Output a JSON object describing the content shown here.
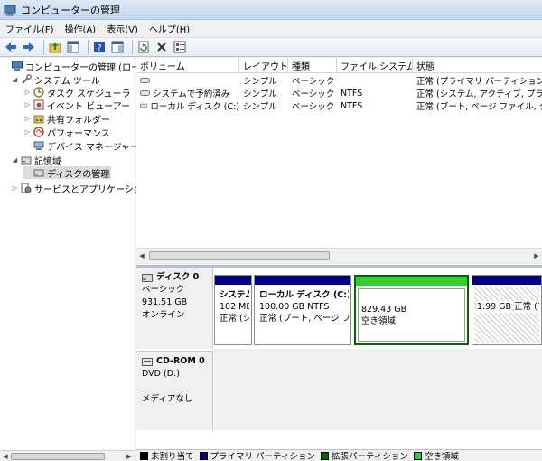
{
  "window": {
    "title": "コンピューターの管理"
  },
  "menu": [
    "ファイル(F)",
    "操作(A)",
    "表示(V)",
    "ヘルプ(H)"
  ],
  "tree": {
    "root": "コンピューターの管理 (ローカル)",
    "system_tools": "システム ツール",
    "task_scheduler": "タスク スケジューラ",
    "event_viewer": "イベント ビューアー",
    "shared_folders": "共有フォルダー",
    "performance": "パフォーマンス",
    "device_manager": "デバイス マネージャー",
    "storage": "記憶域",
    "disk_management": "ディスクの管理",
    "services_apps": "サービスとアプリケーション"
  },
  "volumes": {
    "columns": [
      "ボリューム",
      "レイアウト",
      "種類",
      "ファイル システム",
      "状態"
    ],
    "rows": [
      [
        "",
        "シンプル",
        "ベーシック",
        "",
        "正常 (プライマリ パーティション)"
      ],
      [
        "システムで予約済み",
        "シンプル",
        "ベーシック",
        "NTFS",
        "正常 (システム, アクティブ, プライマリ パーティション)"
      ],
      [
        "ローカル ディスク (C:)",
        "シンプル",
        "ベーシック",
        "NTFS",
        "正常 (ブート, ページ ファイル, クラッシュ ダンプ)"
      ]
    ]
  },
  "disk0": {
    "name": "ディスク 0",
    "type": "ベーシック",
    "size": "931.51 GB",
    "status": "オンライン",
    "partitions": [
      {
        "title": "システム",
        "size": "102 MB",
        "status": "正常 (シ"
      },
      {
        "title": "ローカル ディスク (C:)",
        "size": "100.00 GB NTFS",
        "status": "正常 (ブート, ページ フ"
      },
      {
        "title": "",
        "size": "829.43 GB",
        "status": "空き領域"
      },
      {
        "title": "",
        "size": "1.99 GB",
        "status": "正常 (プライマ"
      }
    ]
  },
  "cdrom": {
    "name": "CD-ROM 0",
    "type": "DVD (D:)",
    "status": "メディアなし"
  },
  "legend": [
    {
      "label": "未割り当て",
      "color": "#000000"
    },
    {
      "label": "プライマリ パーティション",
      "color": "#000080"
    },
    {
      "label": "拡張パーティション",
      "color": "#006400"
    },
    {
      "label": "空き領域",
      "color": "#33cc33"
    }
  ],
  "colors": {
    "primary": "#000080",
    "free_space": "#33cc33",
    "free_border": "#006400"
  }
}
